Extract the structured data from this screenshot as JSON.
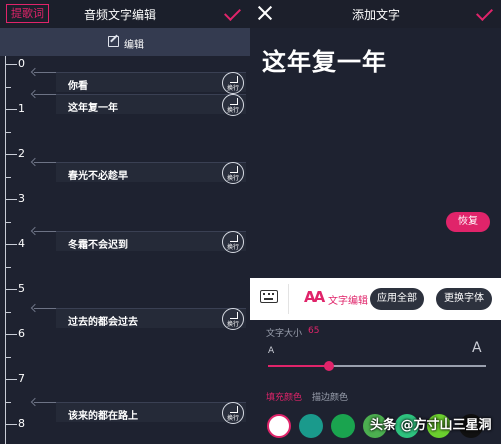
{
  "left": {
    "lyrics_button": "提歌词",
    "title": "音频文字编辑",
    "edit_label": "编辑",
    "seconds": [
      "0",
      "1",
      "2",
      "3",
      "4",
      "5",
      "6",
      "7",
      "8"
    ],
    "rows": [
      {
        "text": "你看",
        "wrap": "换行"
      },
      {
        "text": "这年复一年",
        "wrap": "换行"
      },
      {
        "text": "春光不必趁早",
        "wrap": "换行"
      },
      {
        "text": "冬霜不会迟到",
        "wrap": "换行"
      },
      {
        "text": "过去的都会过去",
        "wrap": "换行"
      },
      {
        "text": "该来的都在路上",
        "wrap": "换行"
      }
    ]
  },
  "right": {
    "title": "添加文字",
    "preview_text": "这年复一年",
    "restore_button": "恢复",
    "toolbar": {
      "aa_icon": "AA",
      "text_edit_label": "文字编辑",
      "apply_all_button": "应用全部",
      "change_font_button": "更换字体"
    },
    "settings": {
      "size_label": "文字大小",
      "size_value": "65",
      "size_fraction": 0.28,
      "a_small": "A",
      "a_large": "A",
      "tab_fill": "填充颜色",
      "tab_stroke": "描边颜色",
      "swatches": [
        "#ffffff",
        "#1a9a8c",
        "#1aa44f",
        "#4caf50",
        "#2ec27e",
        "#6bcf2e",
        "#111111"
      ]
    }
  },
  "watermark": "头条 @方寸山三星洞",
  "accent_color": "#e0246a"
}
